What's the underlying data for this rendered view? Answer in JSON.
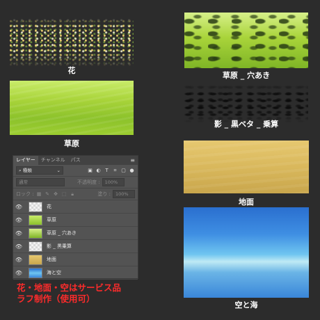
{
  "captions": {
    "flowers": "花",
    "grass_hole": "草原 _ 穴あき",
    "grass": "草原",
    "shadow": "影 _ 黒ベタ _ 乗算",
    "ground": "地面",
    "sky": "空と海"
  },
  "panel": {
    "tabs": [
      "レイヤー",
      "チャンネル",
      "パス"
    ],
    "filter_kind": "種類",
    "blend_mode": "通常",
    "opacity_label": "不透明度 :",
    "opacity_value": "100%",
    "lock_label": "ロック :",
    "fill_label": "塗り :",
    "fill_value": "100%",
    "layers": [
      {
        "name": "花",
        "thumb": "checker"
      },
      {
        "name": "草原",
        "thumb": "grass"
      },
      {
        "name": "草原 _ 穴あき",
        "thumb": "grass"
      },
      {
        "name": "影 _ 黒乗算",
        "thumb": "checker"
      },
      {
        "name": "地面",
        "thumb": "ground"
      },
      {
        "name": "海と空",
        "thumb": "sky"
      }
    ]
  },
  "promo": {
    "line1": "花・地面・空はサービス品",
    "line2": "ラフ制作（使用可）"
  },
  "colors": {
    "background": "#2c2c2c",
    "promo_text": "#ff2b2b",
    "panel": "#535353"
  }
}
